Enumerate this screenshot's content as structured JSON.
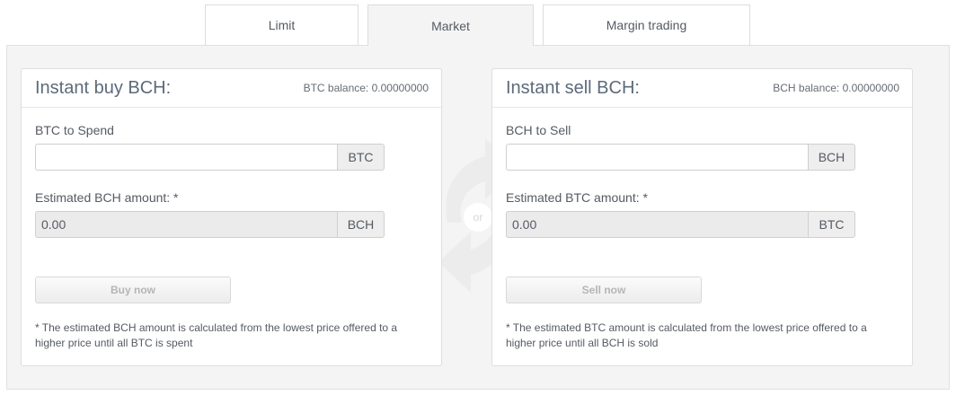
{
  "tabs": [
    {
      "label": "Limit",
      "active": false
    },
    {
      "label": "Market",
      "active": true
    },
    {
      "label": "Margin trading",
      "active": false
    }
  ],
  "buy": {
    "title": "Instant buy BCH:",
    "balance": "BTC balance: 0.00000000",
    "spend_label": "BTC to Spend",
    "spend_value": "",
    "spend_unit": "BTC",
    "estimate_label": "Estimated BCH amount: *",
    "estimate_value": "0.00",
    "estimate_unit": "BCH",
    "button": "Buy now",
    "note": "* The estimated BCH amount is calculated from the lowest price offered to a higher price until all BTC is spent"
  },
  "sell": {
    "title": "Instant sell BCH:",
    "balance": "BCH balance: 0.00000000",
    "spend_label": "BCH to Sell",
    "spend_value": "",
    "spend_unit": "BCH",
    "estimate_label": "Estimated BTC amount: *",
    "estimate_value": "0.00",
    "estimate_unit": "BTC",
    "button": "Sell now",
    "note": "* The estimated BTC amount is calculated from the lowest price offered to a higher price until all BCH is sold"
  },
  "divider": {
    "label": "or",
    "icon": "swap-arrows-icon"
  },
  "colors": {
    "panel_bg": "#f4f4f4",
    "title": "#5d6a7a",
    "disabled_text": "#b5b5b5"
  }
}
